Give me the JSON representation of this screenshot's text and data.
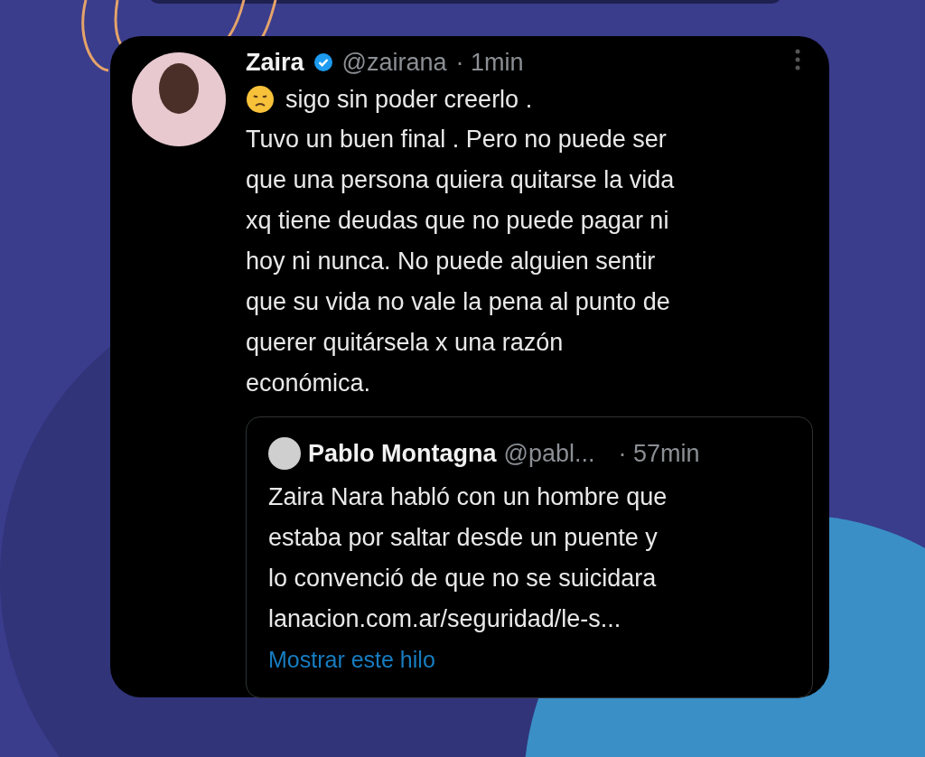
{
  "tweet": {
    "name": "Zaira",
    "verified": true,
    "handle": "@zairana",
    "time": "· 1min",
    "first_line": "sigo sin poder creerlo .",
    "body": "Tuvo un buen final . Pero no puede ser\nque una persona quiera quitarse la vida\nxq tiene deudas que no puede pagar ni\nhoy ni nunca. No puede alguien sentir\nque su vida no vale la pena al punto de\nquerer quitársela x una razón\neconómica.",
    "quote": {
      "name": "Pablo Montagna",
      "handle": "@pabl...",
      "time": "· 57min",
      "body": "Zaira Nara habló con un hombre que\nestaba por saltar desde un puente y\nlo convenció de que no se suicidara\nlanacion.com.ar/seguridad/le-s...",
      "link": "Mostrar este hilo"
    }
  }
}
